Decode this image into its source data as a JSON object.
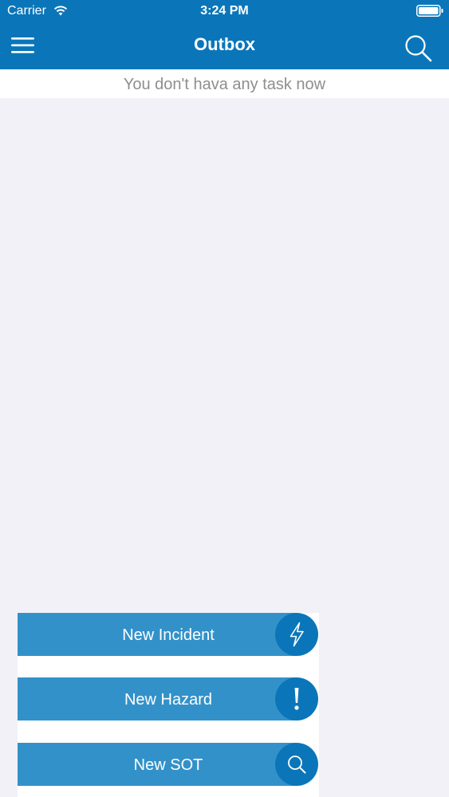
{
  "status_bar": {
    "carrier": "Carrier",
    "time": "3:24 PM"
  },
  "nav": {
    "title": "Outbox",
    "left_icon": "hamburger-menu-icon",
    "right_icon": "search-icon"
  },
  "empty_state": {
    "message": "You don't hava any task now"
  },
  "actions": [
    {
      "label": "New Incident",
      "icon": "lightning-icon"
    },
    {
      "label": "New Hazard",
      "icon": "exclamation-icon"
    },
    {
      "label": "New SOT",
      "icon": "search-icon"
    }
  ],
  "colors": {
    "primary": "#0a76b9",
    "button": "#3391c9",
    "background": "#f2f1f8",
    "muted_text": "#8e8e8e"
  }
}
